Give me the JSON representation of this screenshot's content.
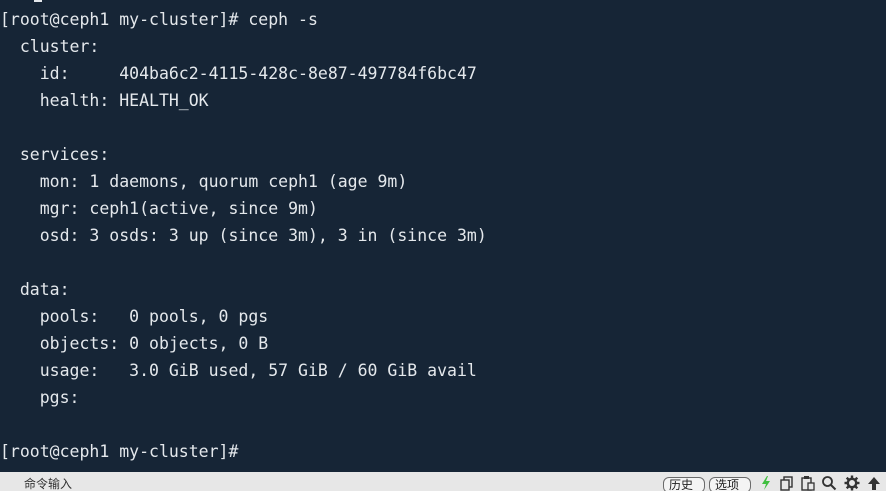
{
  "terminal": {
    "lines": [
      "[root@ceph1 my-cluster]# ceph -s",
      "  cluster:",
      "    id:     404ba6c2-4115-428c-8e87-497784f6bc47",
      "    health: HEALTH_OK",
      "",
      "  services:",
      "    mon: 1 daemons, quorum ceph1 (age 9m)",
      "    mgr: ceph1(active, since 9m)",
      "    osd: 3 osds: 3 up (since 3m), 3 in (since 3m)",
      "",
      "  data:",
      "    pools:   0 pools, 0 pgs",
      "    objects: 0 objects, 0 B",
      "    usage:   3.0 GiB used, 57 GiB / 60 GiB avail",
      "    pgs:",
      "",
      "[root@ceph1 my-cluster]#"
    ]
  },
  "bottombar": {
    "command_input_placeholder": "命令输入",
    "history_label": "历史",
    "options_label": "选项",
    "icons": [
      "lightning-icon",
      "copy-icon",
      "paste-icon",
      "search-icon",
      "gear-icon",
      "up-arrow-icon"
    ]
  },
  "colors": {
    "terminal_bg": "#162536",
    "terminal_fg": "#e4e8ec",
    "bar_bg": "#e7e7e7",
    "lightning": "#3fbf3f"
  }
}
